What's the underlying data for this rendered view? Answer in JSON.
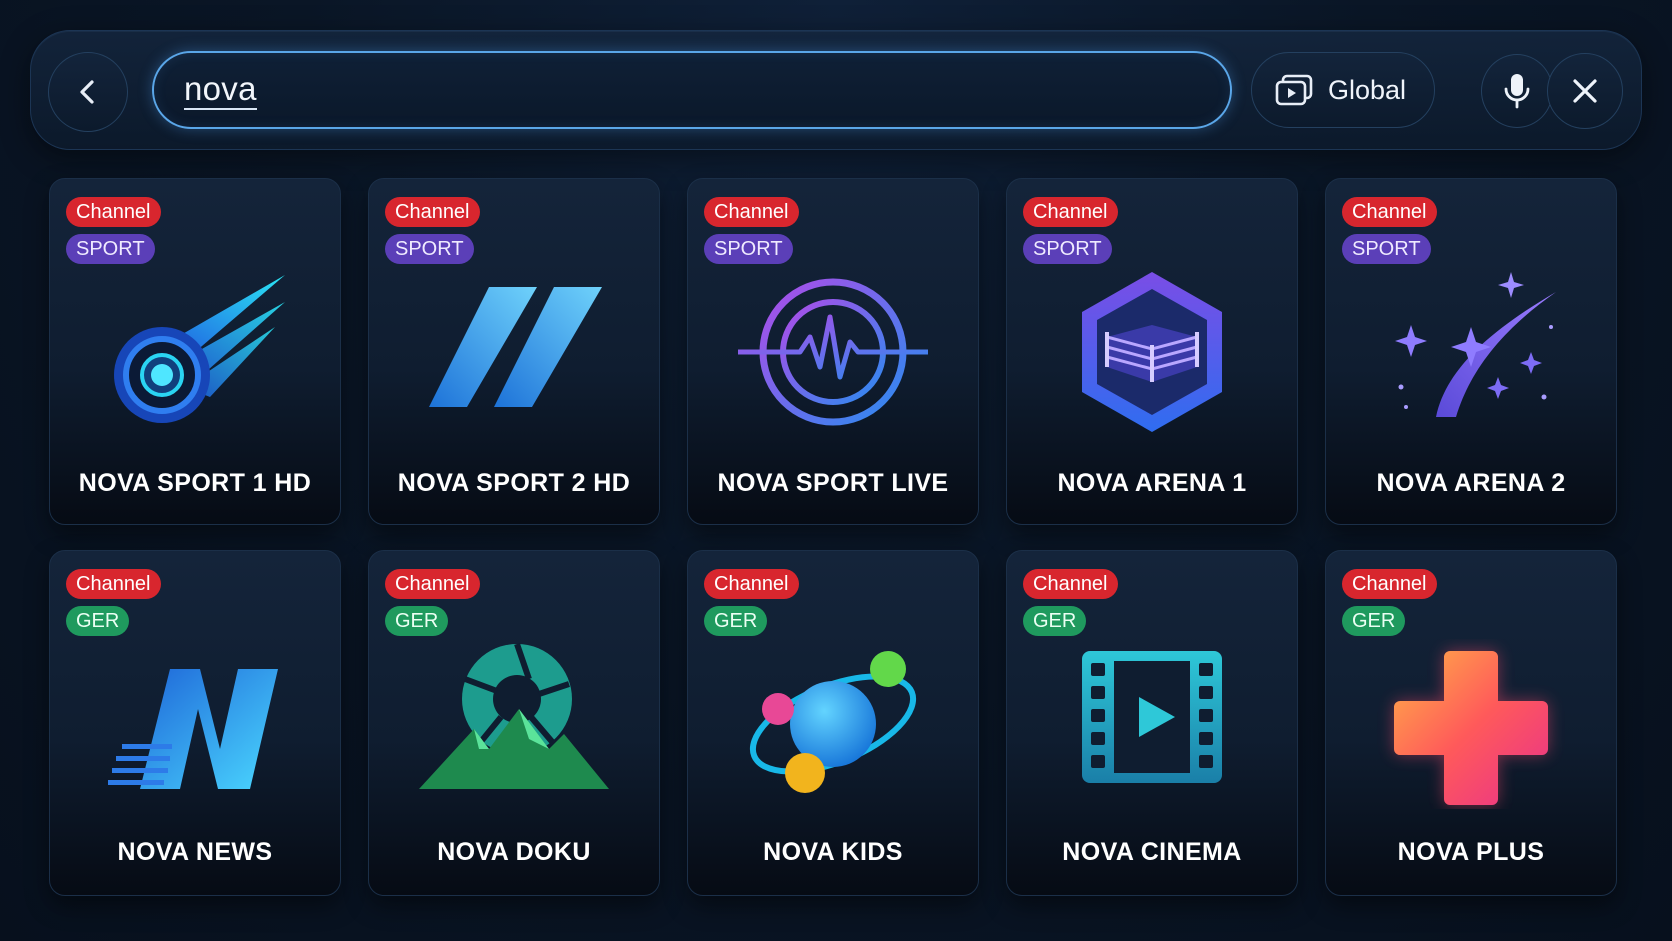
{
  "search": {
    "query": "nova",
    "back_icon": "chevron-left-icon",
    "scope_label": "Global",
    "scope_icon": "play-window-icon",
    "mic_icon": "microphone-icon",
    "close_icon": "close-icon"
  },
  "results": [
    {
      "type": "Channel",
      "tag": "SPORT",
      "title": "NOVA SPORT 1 HD",
      "logo": "comet-logo"
    },
    {
      "type": "Channel",
      "tag": "SPORT",
      "title": "NOVA SPORT 2 HD",
      "logo": "double-slash-logo"
    },
    {
      "type": "Channel",
      "tag": "SPORT",
      "title": "NOVA SPORT LIVE",
      "logo": "pulse-circle-logo"
    },
    {
      "type": "Channel",
      "tag": "SPORT",
      "title": "NOVA ARENA 1",
      "logo": "hexagon-ring-logo"
    },
    {
      "type": "Channel",
      "tag": "SPORT",
      "title": "NOVA ARENA 2",
      "logo": "shooting-star-logo"
    },
    {
      "type": "Channel",
      "tag": "GER",
      "title": "NOVA NEWS",
      "logo": "n-letter-logo"
    },
    {
      "type": "Channel",
      "tag": "GER",
      "title": "NOVA DOKU",
      "logo": "mountain-aperture-logo"
    },
    {
      "type": "Channel",
      "tag": "GER",
      "title": "NOVA KIDS",
      "logo": "planet-orbit-logo"
    },
    {
      "type": "Channel",
      "tag": "GER",
      "title": "NOVA CINEMA",
      "logo": "film-strip-logo"
    },
    {
      "type": "Channel",
      "tag": "GER",
      "title": "NOVA PLUS",
      "logo": "plus-logo"
    }
  ],
  "colors": {
    "channel_badge": "#d8262e",
    "sport_badge": "#5b3fb8",
    "ger_badge": "#1f9a5e",
    "search_border": "#5aa6e8"
  }
}
